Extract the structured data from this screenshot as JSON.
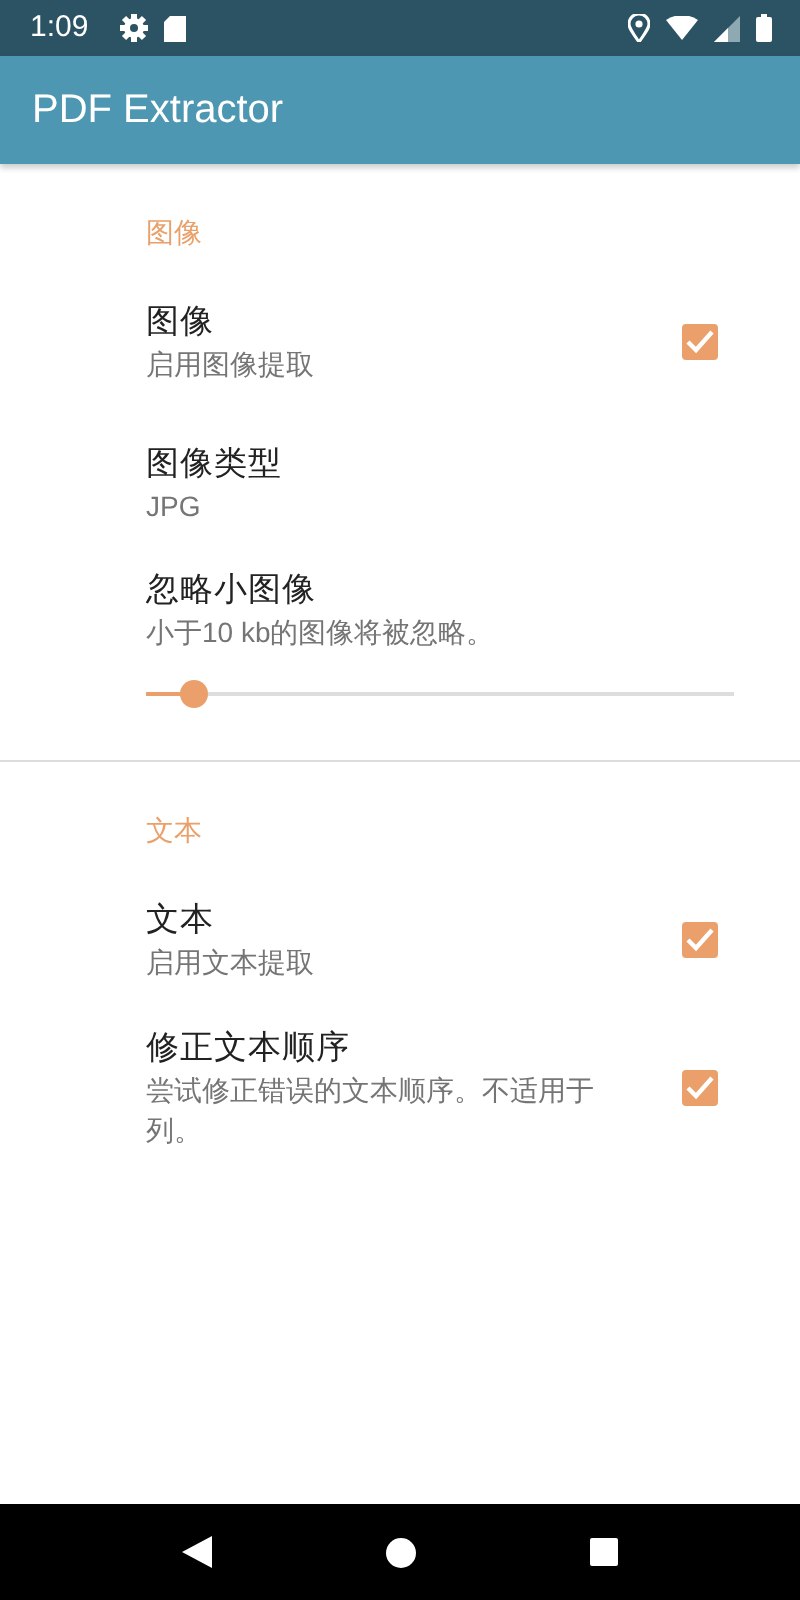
{
  "status_bar": {
    "time": "1:09"
  },
  "app_bar": {
    "title": "PDF Extractor"
  },
  "sections": [
    {
      "title": "图像",
      "items": [
        {
          "kind": "checkbox",
          "title": "图像",
          "summary": "启用图像提取",
          "checked": true
        },
        {
          "kind": "text",
          "title": "图像类型",
          "summary": "JPG"
        },
        {
          "kind": "slider",
          "title": "忽略小图像",
          "summary": "小于10 kb的图像将被忽略。",
          "level": 0.08
        }
      ]
    },
    {
      "title": "文本",
      "items": [
        {
          "kind": "checkbox",
          "title": "文本",
          "summary": "启用文本提取",
          "checked": true
        },
        {
          "kind": "checkbox",
          "title": "修正文本顺序",
          "summary": "尝试修正错误的文本顺序。不适用于列。",
          "checked": true
        }
      ]
    }
  ]
}
